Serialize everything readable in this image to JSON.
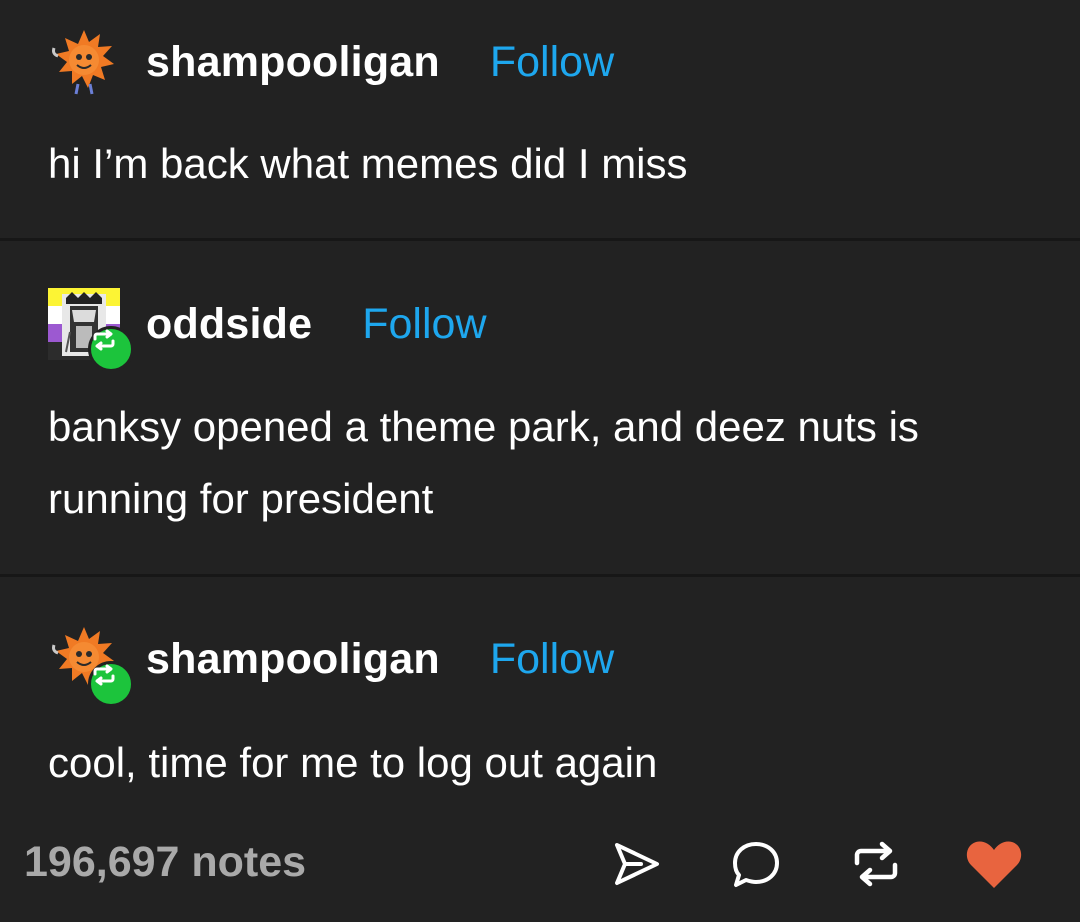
{
  "colors": {
    "background": "#222222",
    "follow": "#1ea7ee",
    "reblog_badge": "#1cc43c",
    "like": "#e8643f",
    "notes": "#a9a9a9"
  },
  "posts": [
    {
      "username": "shampooligan",
      "follow_label": "Follow",
      "text": "hi I’m back what memes did I miss",
      "avatar_icon": "orange-creature-avatar"
    },
    {
      "username": "oddside",
      "follow_label": "Follow",
      "text": "banksy opened a theme park, and deez nuts is running for president",
      "avatar_icon": "nonbinary-flag-avatar",
      "reblog_icon": "reblog-badge-icon"
    },
    {
      "username": "shampooligan",
      "follow_label": "Follow",
      "text": "cool, time for me to log out again",
      "avatar_icon": "orange-creature-avatar",
      "reblog_icon": "reblog-badge-icon"
    }
  ],
  "footer": {
    "notes": "196,697 notes",
    "icons": [
      "share-icon",
      "reply-icon",
      "reblog-icon",
      "like-icon"
    ]
  }
}
